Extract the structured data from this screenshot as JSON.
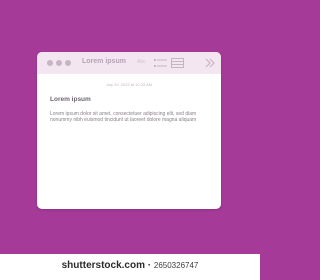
{
  "window": {
    "title": "Lorem ipsum",
    "toolbar_label": "Abc",
    "meta": "July 20, 2023 at 10:25 AM",
    "heading": "Lorem ipsum",
    "body": "Lorem ipsum dolor sit amet, consectetuer adipiscing elit, sed diam nonummy nibh euismod tincidunt ut laoreet dolore magna aliquam"
  },
  "watermark": {
    "brand": "shutterstock.com",
    "separator": " · ",
    "id": "2650326747"
  },
  "colors": {
    "background": "#a53a98",
    "titlebar": "#f3e6f1",
    "window": "#ffffff"
  },
  "icons": [
    "window-dot-icon",
    "list-view-icon",
    "grid-view-icon",
    "chevron-right-double-icon"
  ]
}
